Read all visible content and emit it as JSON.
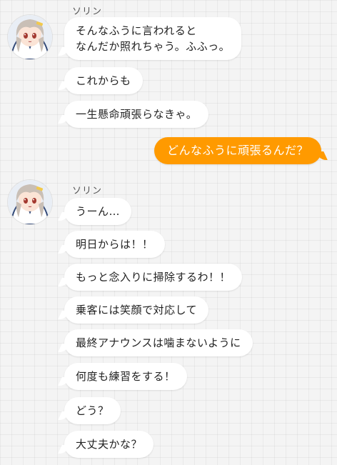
{
  "groups": [
    {
      "sender": "ソリン",
      "avatar_icon": "sorin-avatar-icon",
      "messages": [
        "そんなふうに言われると\nなんだか照れちゃう。ふふっ。",
        "これからも",
        "一生懸命頑張らなきゃ。"
      ]
    },
    {
      "sender": "ソリン",
      "avatar_icon": "sorin-avatar-icon",
      "messages": [
        "うーん…",
        "明日からは！！",
        "もっと念入りに掃除するわ！！",
        "乗客には笑顔で対応して",
        "最終アナウンスは噛まないように",
        "何度も練習をする！",
        "どう？",
        "大丈夫かな？"
      ]
    }
  ],
  "outgoing": {
    "text": "どんなふうに頑張るんだ？",
    "color": "#ff9a00"
  },
  "colors": {
    "incoming_bubble": "#ffffff",
    "outgoing_bubble": "#ff9a00",
    "background": "#f4f4f4"
  }
}
